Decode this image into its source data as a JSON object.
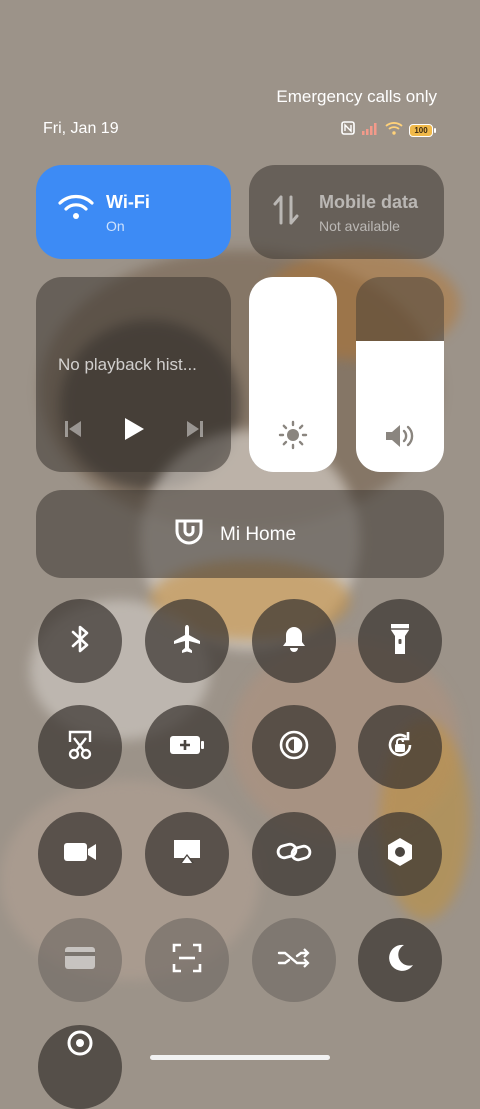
{
  "status": {
    "emergency": "Emergency calls only",
    "date": "Fri, Jan 19",
    "battery": "100"
  },
  "tiles": {
    "wifi": {
      "title": "Wi-Fi",
      "sub": "On"
    },
    "mobile": {
      "title": "Mobile data",
      "sub": "Not available"
    }
  },
  "media": {
    "status": "No playback hist..."
  },
  "sliders": {
    "brightness_level": 1.0,
    "volume_level": 0.67
  },
  "mihome": {
    "label": "Mi Home"
  },
  "toggles": [
    {
      "icon": "bluetooth-icon",
      "active": true
    },
    {
      "icon": "airplane-icon",
      "active": true
    },
    {
      "icon": "bell-icon",
      "active": true
    },
    {
      "icon": "flashlight-icon",
      "active": true
    },
    {
      "icon": "screenshot-icon",
      "active": true
    },
    {
      "icon": "battery-saver-icon",
      "active": true
    },
    {
      "icon": "dark-mode-icon",
      "active": true
    },
    {
      "icon": "rotation-lock-icon",
      "active": true
    },
    {
      "icon": "video-icon",
      "active": true
    },
    {
      "icon": "cast-icon",
      "active": true
    },
    {
      "icon": "link-icon",
      "active": true
    },
    {
      "icon": "settings-hex-icon",
      "active": true
    },
    {
      "icon": "card-icon",
      "active": false
    },
    {
      "icon": "scan-icon",
      "active": false
    },
    {
      "icon": "shuffle-icon",
      "active": false
    },
    {
      "icon": "moon-icon",
      "active": true
    },
    {
      "icon": "location-icon",
      "active": true
    }
  ]
}
